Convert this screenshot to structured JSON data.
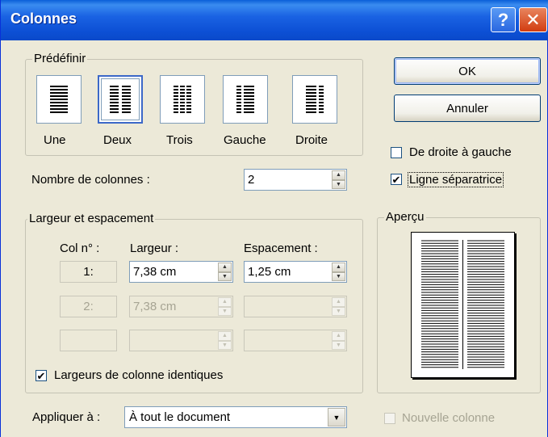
{
  "window": {
    "title": "Colonnes",
    "help_glyph": "?",
    "close_glyph": "✕"
  },
  "predefinir": {
    "label": "Prédéfinir",
    "presets": [
      {
        "label": "Une",
        "icon": "one-column-icon",
        "selected": false
      },
      {
        "label": "Deux",
        "icon": "two-columns-icon",
        "selected": true
      },
      {
        "label": "Trois",
        "icon": "three-columns-icon",
        "selected": false
      },
      {
        "label": "Gauche",
        "icon": "left-column-icon",
        "selected": false
      },
      {
        "label": "Droite",
        "icon": "right-column-icon",
        "selected": false
      }
    ]
  },
  "buttons": {
    "ok": "OK",
    "cancel": "Annuler"
  },
  "options": {
    "rtl": {
      "label": "De droite à gauche",
      "checked": false
    },
    "separator": {
      "label": "Ligne séparatrice",
      "checked": true
    },
    "new_column": {
      "label": "Nouvelle colonne",
      "checked": false,
      "disabled": true
    }
  },
  "nombre": {
    "label": "Nombre de colonnes :",
    "value": "2"
  },
  "largeur": {
    "label": "Largeur et espacement",
    "col_header": "Col n° :",
    "width_header": "Largeur :",
    "spacing_header": "Espacement :",
    "rows": [
      {
        "col": "1:",
        "width": "7,38 cm",
        "spacing": "1,25 cm",
        "enabled": true
      },
      {
        "col": "2:",
        "width": "7,38 cm",
        "spacing": "",
        "enabled": false
      },
      {
        "col": "",
        "width": "",
        "spacing": "",
        "enabled": false
      }
    ],
    "equal_widths": {
      "label": "Largeurs de colonne identiques",
      "checked": true
    }
  },
  "apercu": {
    "label": "Aperçu"
  },
  "appliquer": {
    "label": "Appliquer à :",
    "value": "À tout le document"
  },
  "check_glyph": "✔"
}
